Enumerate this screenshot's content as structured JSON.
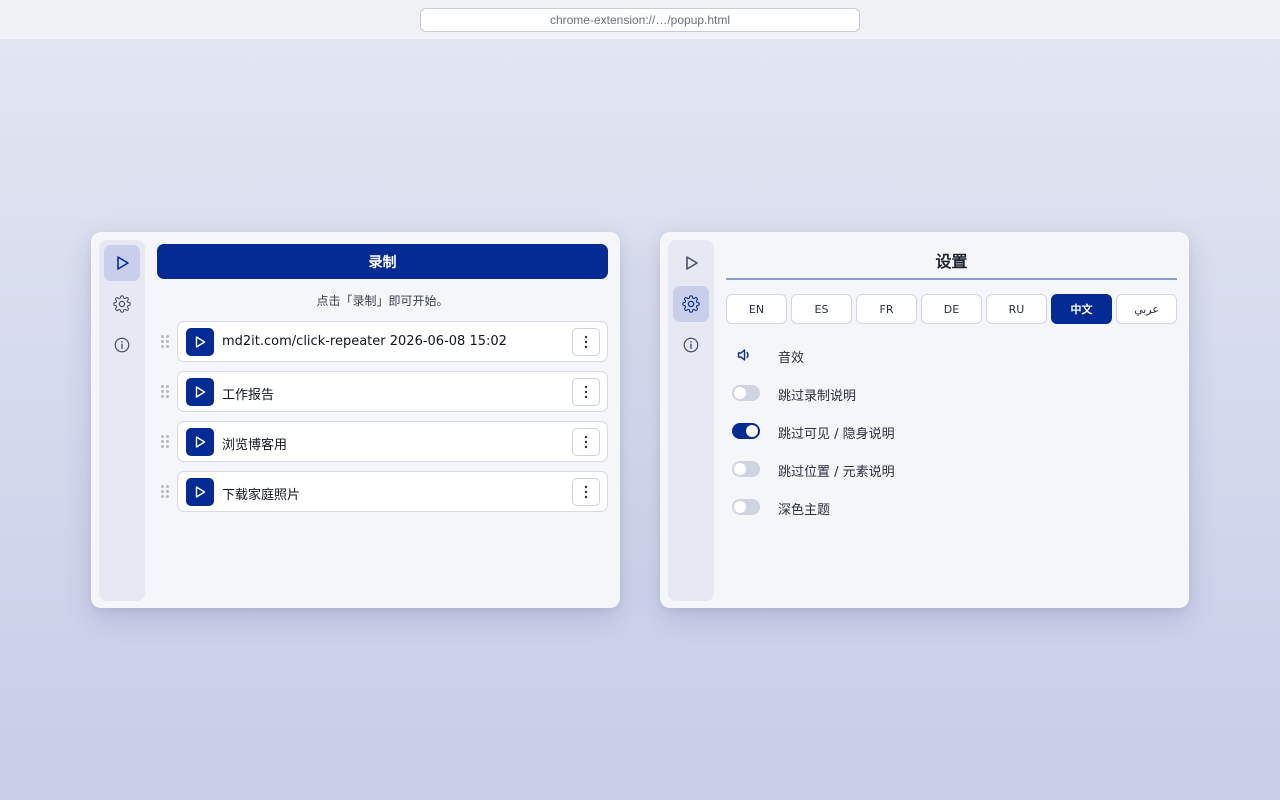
{
  "browser": {
    "url": "chrome-extension://…/popup.html"
  },
  "left_panel": {
    "record_label": "录制",
    "hint": "点击「录制」即可开始。",
    "items": [
      {
        "label": "md2it.com/click-repeater 2026-06-08 15:02"
      },
      {
        "label": "工作报告"
      },
      {
        "label": "浏览博客用"
      },
      {
        "label": "下载家庭照片"
      }
    ]
  },
  "right_panel": {
    "title": "设置",
    "languages": [
      {
        "code": "EN",
        "active": false
      },
      {
        "code": "ES",
        "active": false
      },
      {
        "code": "FR",
        "active": false
      },
      {
        "code": "DE",
        "active": false
      },
      {
        "code": "RU",
        "active": false
      },
      {
        "code": "中文",
        "active": true
      },
      {
        "code": "عربي",
        "active": false
      }
    ],
    "settings": [
      {
        "label": "音效",
        "control": "speaker-icon"
      },
      {
        "label": "跳过录制说明",
        "control": "toggle",
        "on": false
      },
      {
        "label": "跳过可见 / 隐身说明",
        "control": "toggle",
        "on": true
      },
      {
        "label": "跳过位置 / 元素说明",
        "control": "toggle",
        "on": false
      },
      {
        "label": "深色主题",
        "control": "toggle",
        "on": false
      }
    ]
  },
  "colors": {
    "accent": "#042a93",
    "panel": "#f5f6fa",
    "rail": "#e6e8f3",
    "rail_active": "#c9cfea"
  },
  "icons": {
    "rail": [
      "play-icon",
      "gear-icon",
      "info-icon"
    ],
    "item_actions": [
      "play-icon",
      "more-vertical-icon"
    ],
    "drag": "drag-handle-icon"
  }
}
